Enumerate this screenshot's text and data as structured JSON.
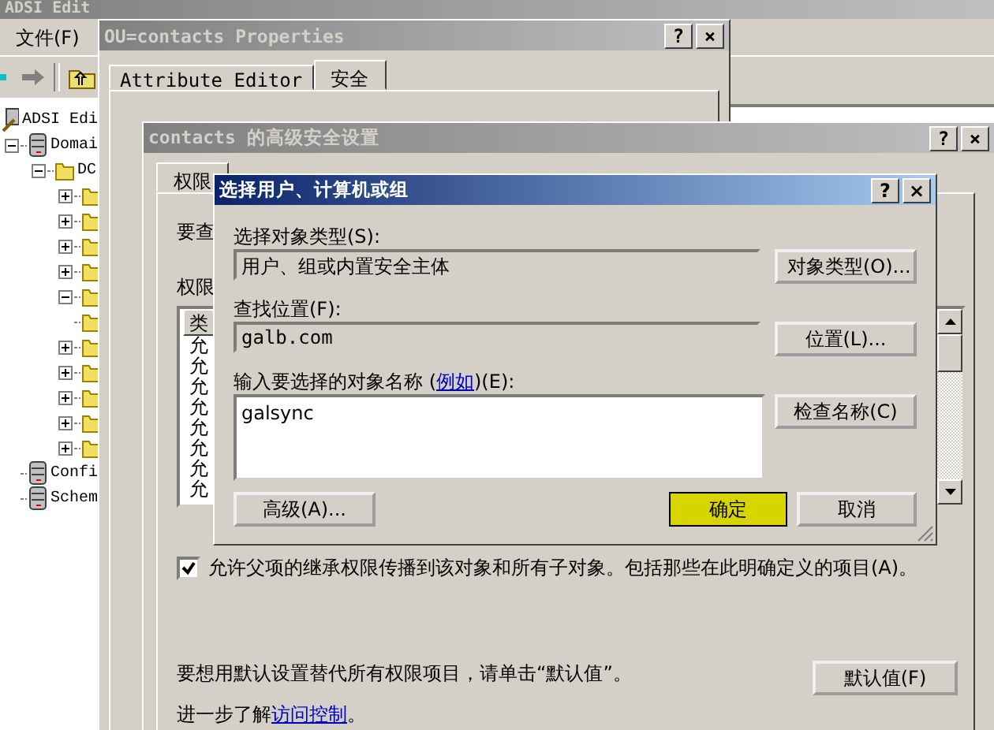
{
  "main_window": {
    "title": "ADSI Edit",
    "menu": [
      "文件(F)"
    ],
    "tree": [
      {
        "label": "ADSI Edi",
        "kind": "root",
        "children": [
          {
            "label": "Domai",
            "kind": "server",
            "expanded": true,
            "children": [
              {
                "label": "DC",
                "kind": "folder",
                "expanded": true,
                "children": [
                  {
                    "kind": "folder",
                    "expanded": false
                  },
                  {
                    "kind": "folder",
                    "expanded": false
                  },
                  {
                    "kind": "folder",
                    "expanded": false
                  },
                  {
                    "kind": "folder",
                    "expanded": false
                  },
                  {
                    "kind": "folder",
                    "expanded": true
                  },
                  {
                    "kind": "folder"
                  },
                  {
                    "kind": "folder",
                    "expanded": false
                  },
                  {
                    "kind": "folder",
                    "expanded": false
                  },
                  {
                    "kind": "folder",
                    "expanded": false
                  },
                  {
                    "kind": "folder",
                    "expanded": false
                  },
                  {
                    "kind": "folder",
                    "expanded": false
                  }
                ]
              }
            ]
          },
          {
            "label": "Confi",
            "kind": "server"
          },
          {
            "label": "Schem",
            "kind": "server"
          }
        ]
      }
    ]
  },
  "properties_window": {
    "title": "OU=contacts Properties",
    "caption_buttons": [
      "?",
      "×"
    ],
    "tabs": [
      {
        "label": "Attribute Editor",
        "selected": false
      },
      {
        "label": "安全",
        "selected": true
      }
    ]
  },
  "advanced_window": {
    "title": "contacts 的高级安全设置",
    "caption_buttons": [
      "?",
      "×"
    ],
    "tabs": [
      {
        "label": "权限",
        "selected": true
      }
    ],
    "intro": "要查",
    "list_label": "权限",
    "list_header": "类",
    "list_rows": [
      "允",
      "允",
      "允",
      "允",
      "允",
      "允",
      "允",
      "允"
    ],
    "inherit": {
      "label": "允许父项的继承权限传播到该对象和所有子对象。包括那些在此明确定义的项目(A)。",
      "checked": true
    },
    "default_text": "要想用默认设置替代所有权限项目，请单击“默认值”。",
    "default_button": "默认值(F)",
    "learn_text": "进一步了解",
    "learn_link": "访问控制",
    "learn_end": "。"
  },
  "select_dialog": {
    "title": "选择用户、计算机或组",
    "caption_buttons": [
      "?",
      "×"
    ],
    "type_label": "选择对象类型(S):",
    "type_value": "用户、组或内置安全主体",
    "type_button": "对象类型(O)...",
    "location_label": "查找位置(F):",
    "location_value": "galb.com",
    "location_button": "位置(L)...",
    "names_label": "输入要选择的对象名称 (",
    "names_link": "例如",
    "names_label_end": ")(E):",
    "names_value": "galsync",
    "check_button": "检查名称(C)",
    "buttons": [
      {
        "label": "高级(A)...",
        "kind": "advanced",
        "highlighted": false
      },
      {
        "label": "确定",
        "kind": "ok",
        "highlighted": true
      },
      {
        "label": "取消",
        "kind": "cancel",
        "highlighted": false
      }
    ]
  }
}
